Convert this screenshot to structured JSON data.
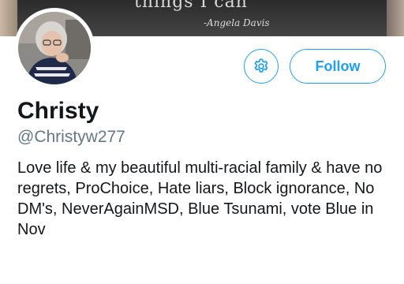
{
  "banner": {
    "quote_text": "things I can",
    "author": "-Angela Davis"
  },
  "profile": {
    "name": "Christy",
    "handle": "@Christyw277",
    "bio": "Love life & my beautiful multi-racial family & have no regrets, ProChoice, Hate liars, Block ignorance, No DM's, NeverAgainMSD, Blue Tsunami, vote Blue in Nov"
  },
  "actions": {
    "settings_icon": "gear-icon",
    "follow_label": "Follow"
  },
  "colors": {
    "accent": "#1da1f2",
    "text": "#14171a",
    "secondary_text": "#657786"
  }
}
